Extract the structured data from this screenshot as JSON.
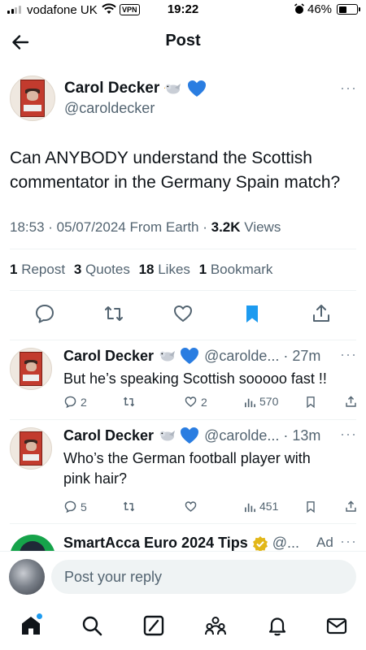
{
  "status_bar": {
    "carrier": "vodafone UK",
    "vpn": "VPN",
    "time": "19:22",
    "battery": "46%",
    "battery_level": 0.46
  },
  "header": {
    "title": "Post"
  },
  "post": {
    "name": "Carol Decker",
    "name_emojis": [
      "dove-emoji",
      "blue-heart-emoji"
    ],
    "handle": "@caroldecker",
    "text": "Can ANYBODY understand the Scottish commentator in the Germany Spain match?",
    "time": "18:53",
    "date": "05/07/2024",
    "source": "From Earth",
    "views_count": "3.2K",
    "views_label": "Views",
    "stats": [
      {
        "count": "1",
        "label": "Repost"
      },
      {
        "count": "3",
        "label": "Quotes"
      },
      {
        "count": "18",
        "label": "Likes"
      },
      {
        "count": "1",
        "label": "Bookmark"
      }
    ]
  },
  "replies": [
    {
      "name": "Carol Decker",
      "handle": "@carolde...",
      "age": "27m",
      "text": "But he’s speaking Scottish sooooo fast !!",
      "replies": "2",
      "reposts": "",
      "likes": "2",
      "views": "570"
    },
    {
      "name": "Carol Decker",
      "handle": "@carolde...",
      "age": "13m",
      "text": "Who’s the German football player with pink hair?",
      "replies": "5",
      "reposts": "",
      "likes": "",
      "views": "451"
    }
  ],
  "ad": {
    "name": "SmartAcca Euro 2024 Tips",
    "handle": "@...",
    "label": "Ad"
  },
  "reply_bar": {
    "placeholder": "Post your reply"
  },
  "tabs": [
    "home-icon",
    "search-icon",
    "grok-icon",
    "communities-icon",
    "notifications-icon",
    "messages-icon"
  ],
  "colors": {
    "accent": "#1d9bf0",
    "text": "#0f1419",
    "muted": "#536471",
    "divider": "#eff3f4"
  }
}
